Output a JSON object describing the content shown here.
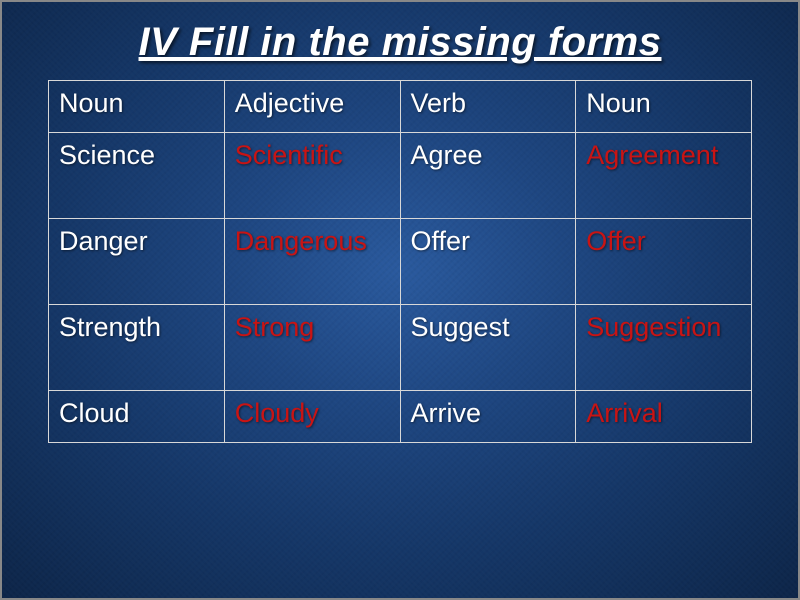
{
  "title": "IV Fill in the missing forms",
  "headers": [
    "Noun",
    "Adjective",
    "Verb",
    "Noun"
  ],
  "rows": [
    {
      "c0": "Science",
      "c1": "Scientific",
      "c2": "Agree",
      "c3": "Agreement"
    },
    {
      "c0": "Danger",
      "c1": "Dangerous",
      "c2": "Offer",
      "c3": "Offer"
    },
    {
      "c0": "Strength",
      "c1": "Strong",
      "c2": "Suggest",
      "c3": "Suggestion"
    },
    {
      "c0": "Cloud",
      "c1": "Cloudy",
      "c2": "Arrive",
      "c3": "Arrival"
    }
  ]
}
